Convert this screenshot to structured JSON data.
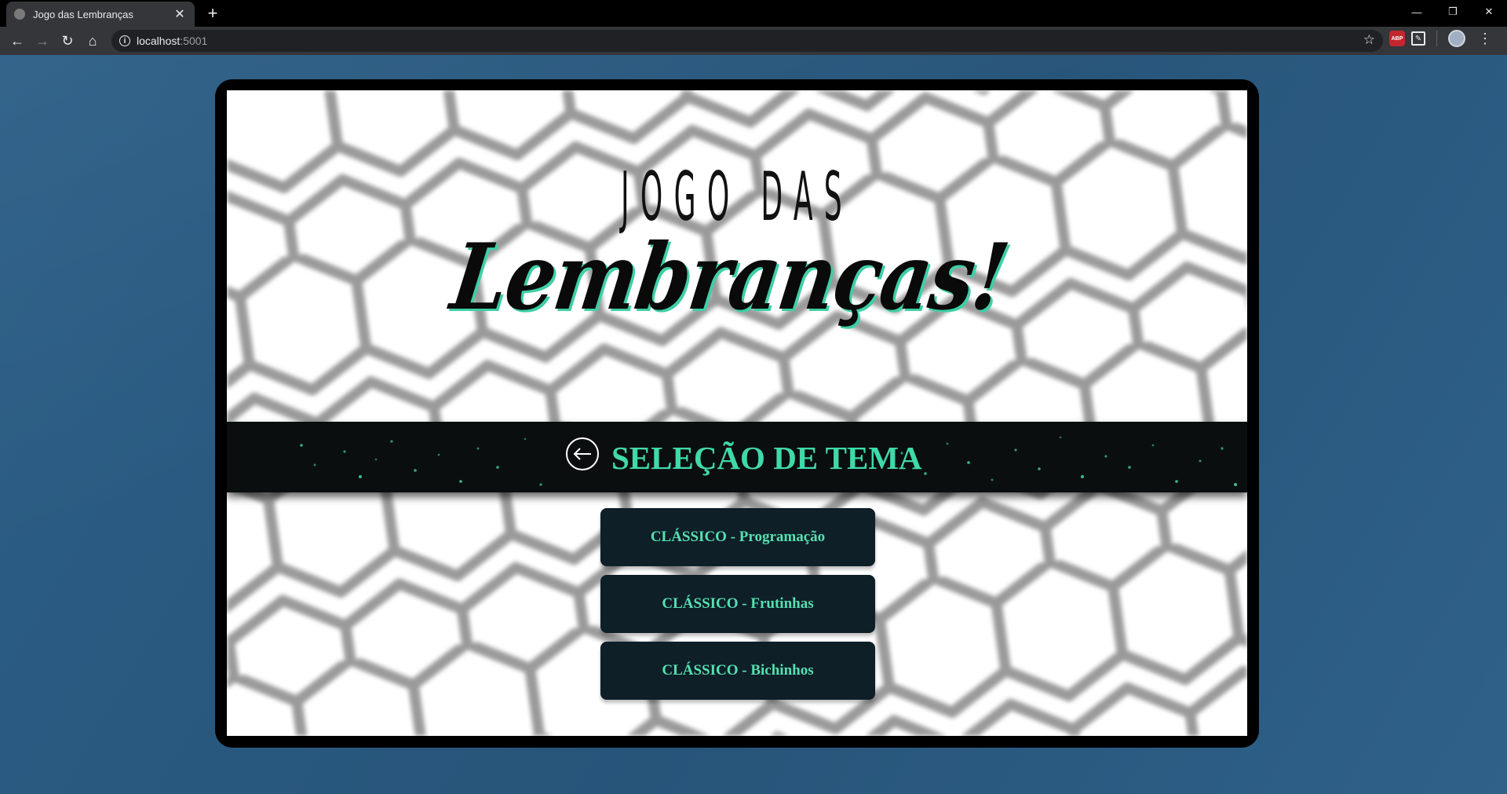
{
  "browser": {
    "tab_title": "Jogo das Lembranças",
    "url_host": "localhost",
    "url_port": ":5001",
    "extension_abp_label": "ABP"
  },
  "game": {
    "logo_line1": "JOGO DAS",
    "logo_line2": "Lembranças!",
    "accent_color": "#40d9a9",
    "panel_color": "#0e1f28",
    "screen_title": "SELEÇÃO DE TEMA",
    "themes": [
      {
        "label": "CLÁSSICO - Programação"
      },
      {
        "label": "CLÁSSICO - Frutinhas"
      },
      {
        "label": "CLÁSSICO - Bichinhos"
      }
    ]
  }
}
